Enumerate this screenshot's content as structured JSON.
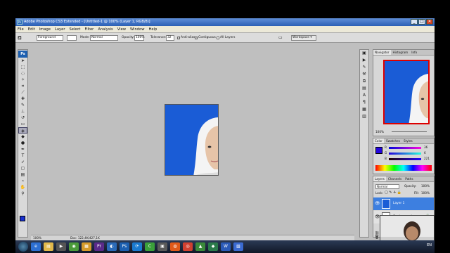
{
  "window": {
    "title": "Adobe Photoshop CS3 Extended - [Untitled-1 @ 100% (Layer 1, RGB/8)]",
    "controls": {
      "minimize": "_",
      "maximize": "□",
      "close": "✕"
    }
  },
  "menu": [
    "File",
    "Edit",
    "Image",
    "Layer",
    "Select",
    "Filter",
    "Analysis",
    "View",
    "Window",
    "Help"
  ],
  "options": {
    "fill_source": "Foreground",
    "mode_label": "Mode:",
    "mode_value": "Normal",
    "opacity_label": "Opacity:",
    "opacity_value": "100%",
    "tolerance_label": "Tolerance:",
    "tolerance_value": "32",
    "antialias_label": "Anti-alias",
    "contiguous_label": "Contiguous",
    "all_layers_label": "All Layers",
    "workspace_label": "Workspace ▾"
  },
  "tools_badge": "Ps",
  "status": {
    "zoom": "100%",
    "doc": "Doc: 122,4K/427,1K"
  },
  "navigator": {
    "tabs": [
      "Navigator",
      "Histogram",
      "Info"
    ],
    "zoom": "100%"
  },
  "color_panel": {
    "tabs": [
      "Color",
      "Swatches",
      "Styles"
    ],
    "r_label": "R",
    "r_value": "36",
    "g_label": "G",
    "g_value": "6",
    "b_label": "B",
    "b_value": "221"
  },
  "layers_panel": {
    "tabs": [
      "Layers",
      "Channels",
      "Paths"
    ],
    "blend": "Normal",
    "opacity_label": "Opacity:",
    "opacity_value": "100%",
    "lock_label": "Lock:",
    "fill_label": "Fill:",
    "fill_value": "100%",
    "layers": [
      "Layer 1",
      "Background"
    ]
  },
  "taskbar": {
    "language": "EN"
  },
  "colors": {
    "canvas_blue": "#1a5cd6",
    "foreground": "#2406dd",
    "selected_layer": "#3d7fe0"
  }
}
